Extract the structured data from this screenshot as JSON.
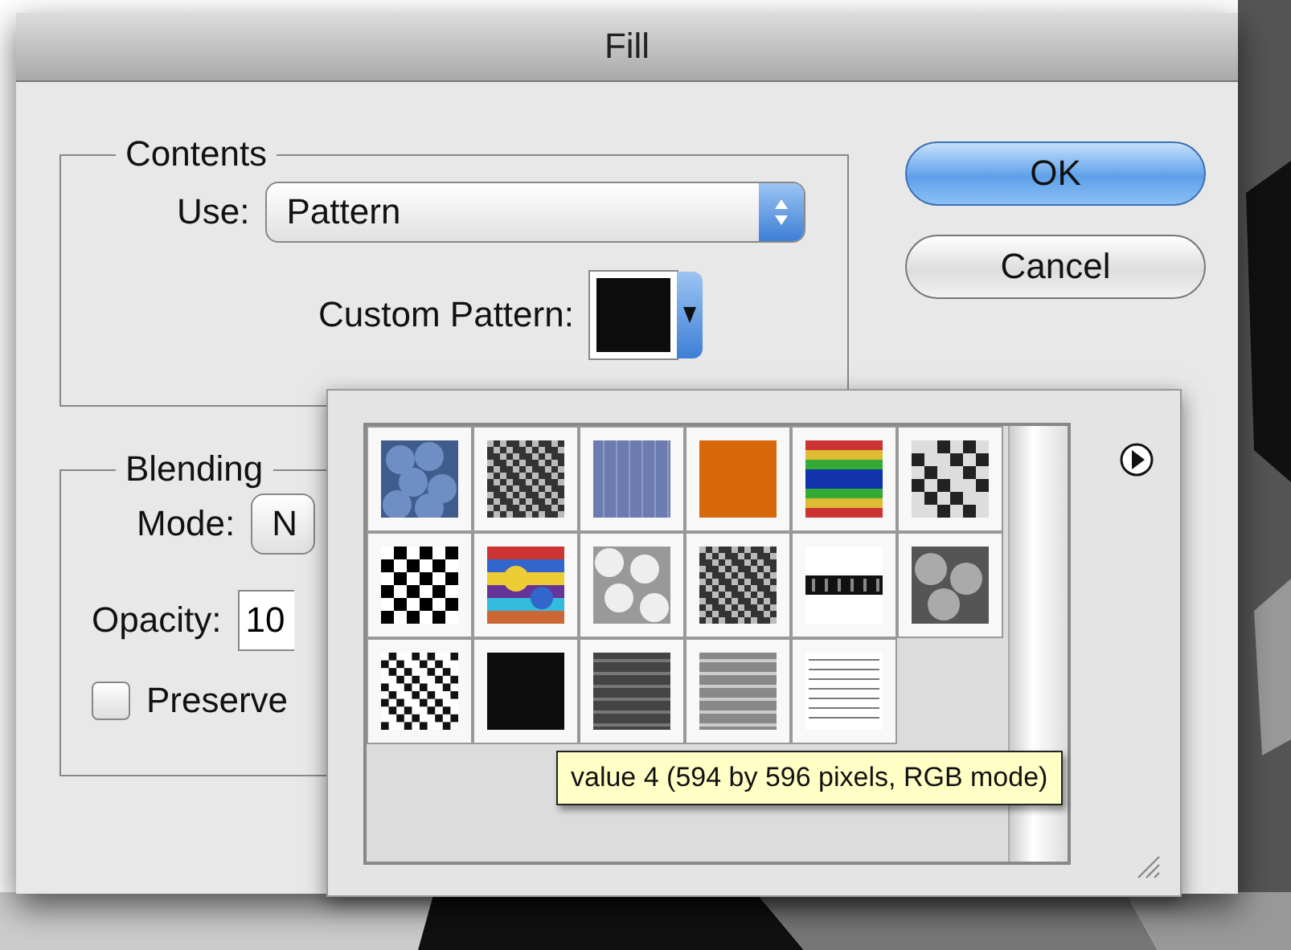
{
  "window": {
    "title": "Fill"
  },
  "contents": {
    "legend": "Contents",
    "use_label": "Use:",
    "use_value": "Pattern",
    "custom_pattern_label": "Custom Pattern:",
    "custom_pattern": {
      "kind": "dark"
    }
  },
  "blending": {
    "legend": "Blending",
    "mode_label": "Mode:",
    "mode_value": "N",
    "opacity_label": "Opacity:",
    "opacity_value": "10",
    "preserve_label": "Preserve",
    "preserve_checked": false
  },
  "buttons": [
    {
      "label": "OK",
      "default": true
    },
    {
      "label": "Cancel",
      "default": false
    }
  ],
  "pattern_picker": {
    "patterns": [
      {
        "kind": "bubbles"
      },
      {
        "kind": "noise"
      },
      {
        "kind": "denim"
      },
      {
        "kind": "orange"
      },
      {
        "kind": "rainbow"
      },
      {
        "kind": "rock"
      },
      {
        "kind": "checker"
      },
      {
        "kind": "confetti"
      },
      {
        "kind": "clouds"
      },
      {
        "kind": "noise"
      },
      {
        "kind": "band"
      },
      {
        "kind": "clouds-dark"
      },
      {
        "kind": "noise-coarse"
      },
      {
        "kind": "dark"
      },
      {
        "kind": "lines-dark"
      },
      {
        "kind": "lines-light"
      },
      {
        "kind": "text"
      }
    ],
    "tooltip": "value 4 (594 by 596 pixels, RGB mode)"
  }
}
